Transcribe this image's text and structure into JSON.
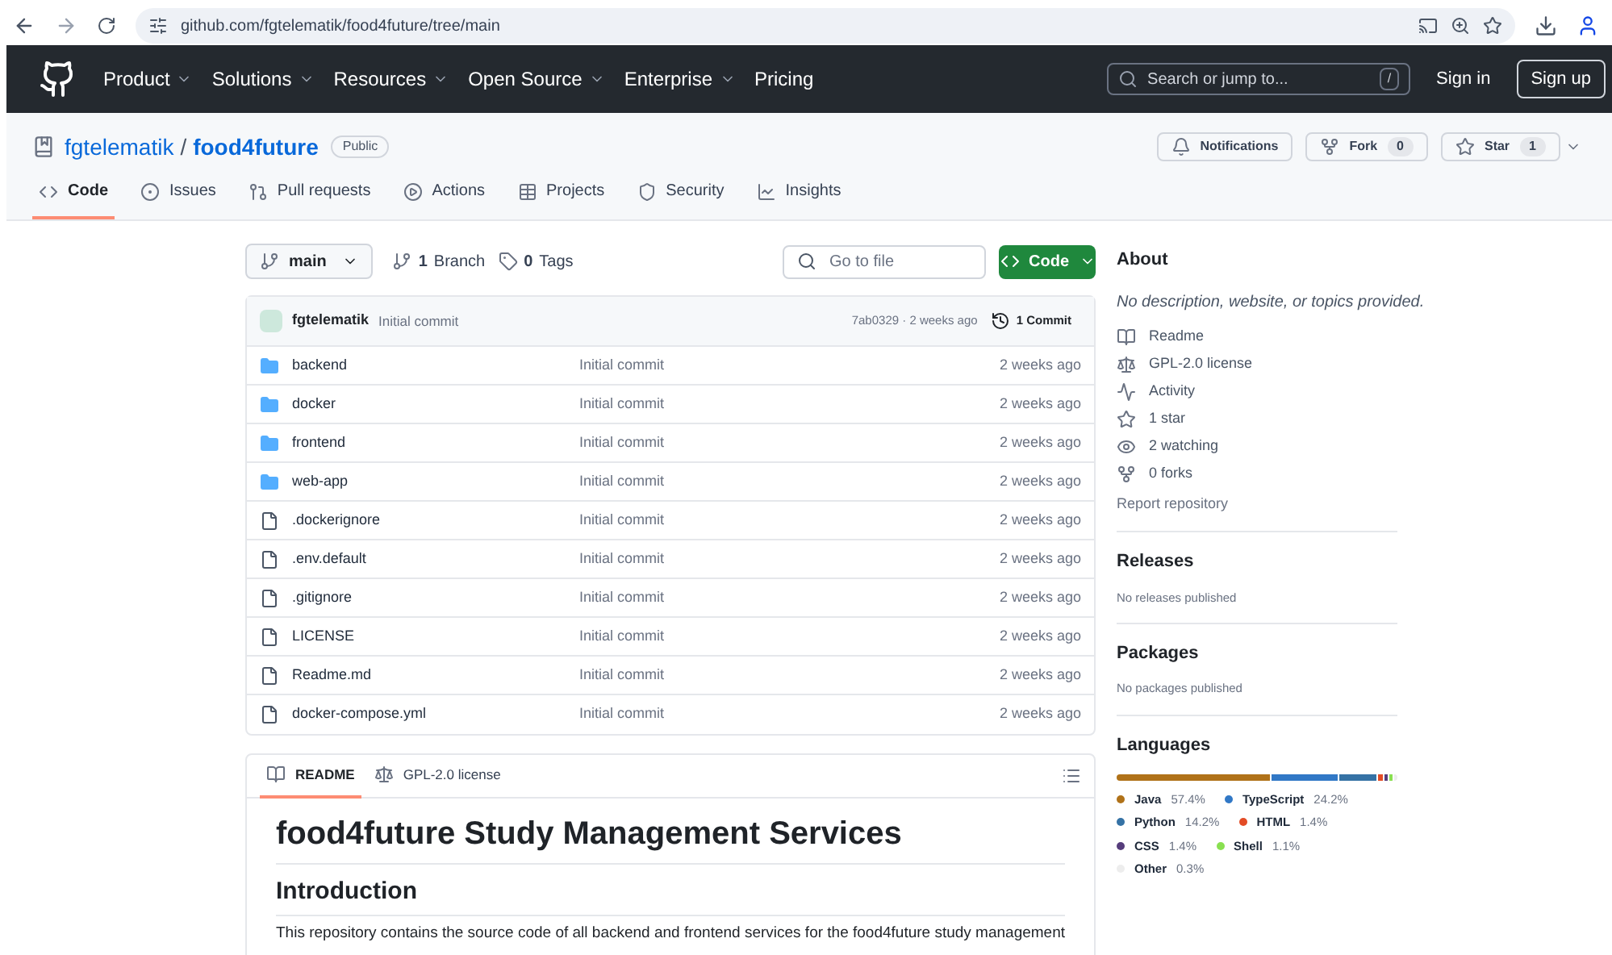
{
  "browser": {
    "url": "github.com/fgtelematik/food4future/tree/main"
  },
  "header": {
    "nav": [
      "Product",
      "Solutions",
      "Resources",
      "Open Source",
      "Enterprise"
    ],
    "pricing": "Pricing",
    "search": {
      "placeholder": "Search or jump to...",
      "key": "/"
    },
    "sign_in": "Sign in",
    "sign_up": "Sign up"
  },
  "repo": {
    "owner": "fgtelematik",
    "separator": "/",
    "name": "food4future",
    "visibility": "Public",
    "actions": [
      {
        "kind": "bell",
        "label": "Notifications"
      },
      {
        "kind": "fork",
        "label": "Fork",
        "count": "0"
      },
      {
        "kind": "star",
        "label": "Star",
        "count": "1"
      }
    ]
  },
  "tabs": [
    {
      "kind": "code",
      "label": "Code",
      "selected": true
    },
    {
      "kind": "issue",
      "label": "Issues",
      "selected": false
    },
    {
      "kind": "pr",
      "label": "Pull requests",
      "selected": false
    },
    {
      "kind": "play",
      "label": "Actions",
      "selected": false
    },
    {
      "kind": "table",
      "label": "Projects",
      "selected": false
    },
    {
      "kind": "shield",
      "label": "Security",
      "selected": false
    },
    {
      "kind": "graph",
      "label": "Insights",
      "selected": false
    }
  ],
  "toolbar": {
    "branch": "main",
    "branches": {
      "count": "1",
      "label": "Branch"
    },
    "tags": {
      "count": "0",
      "label": "Tags"
    },
    "goto": {
      "placeholder": "Go to file"
    },
    "code_button": "Code"
  },
  "latest_commit": {
    "author": "fgtelematik",
    "message": "Initial commit",
    "hash_time": "7ab0329 · 2 weeks ago",
    "commits": "1 Commit"
  },
  "files": [
    {
      "kind": "folder",
      "name": "backend",
      "message": "Initial commit",
      "time": "2 weeks ago"
    },
    {
      "kind": "folder",
      "name": "docker",
      "message": "Initial commit",
      "time": "2 weeks ago"
    },
    {
      "kind": "folder",
      "name": "frontend",
      "message": "Initial commit",
      "time": "2 weeks ago"
    },
    {
      "kind": "folder",
      "name": "web-app",
      "message": "Initial commit",
      "time": "2 weeks ago"
    },
    {
      "kind": "file",
      "name": ".dockerignore",
      "message": "Initial commit",
      "time": "2 weeks ago"
    },
    {
      "kind": "file",
      "name": ".env.default",
      "message": "Initial commit",
      "time": "2 weeks ago"
    },
    {
      "kind": "file",
      "name": ".gitignore",
      "message": "Initial commit",
      "time": "2 weeks ago"
    },
    {
      "kind": "file",
      "name": "LICENSE",
      "message": "Initial commit",
      "time": "2 weeks ago"
    },
    {
      "kind": "file",
      "name": "Readme.md",
      "message": "Initial commit",
      "time": "2 weeks ago"
    },
    {
      "kind": "file",
      "name": "docker-compose.yml",
      "message": "Initial commit",
      "time": "2 weeks ago"
    }
  ],
  "readme": {
    "tabs": [
      {
        "kind": "book",
        "label": "README",
        "selected": true
      },
      {
        "kind": "scale",
        "label": "GPL-2.0 license",
        "selected": false
      }
    ],
    "title": "food4future Study Management Services",
    "heading": "Introduction",
    "paragraph": "This repository contains the source code of all backend and frontend services for the food4future study management"
  },
  "about": {
    "title": "About",
    "description": "No description, website, or topics provided.",
    "items": [
      {
        "kind": "book",
        "label": "Readme"
      },
      {
        "kind": "scale",
        "label": "GPL-2.0 license"
      },
      {
        "kind": "pulse",
        "label": "Activity"
      },
      {
        "kind": "star",
        "label": "1 star"
      },
      {
        "kind": "eye",
        "label": "2 watching"
      },
      {
        "kind": "fork",
        "label": "0 forks"
      }
    ],
    "report": "Report repository"
  },
  "releases": {
    "title": "Releases",
    "note": "No releases published"
  },
  "packages": {
    "title": "Packages",
    "note": "No packages published"
  },
  "languages": {
    "title": "Languages",
    "items": [
      {
        "name": "Java",
        "percent": "57.4%",
        "color": "#b07219"
      },
      {
        "name": "TypeScript",
        "percent": "24.2%",
        "color": "#3178c6"
      },
      {
        "name": "Python",
        "percent": "14.2%",
        "color": "#3572a5"
      },
      {
        "name": "HTML",
        "percent": "1.4%",
        "color": "#e34c26"
      },
      {
        "name": "CSS",
        "percent": "1.4%",
        "color": "#563d7c"
      },
      {
        "name": "Shell",
        "percent": "1.1%",
        "color": "#89e051"
      },
      {
        "name": "Other",
        "percent": "0.3%",
        "color": "#ededed"
      }
    ]
  }
}
